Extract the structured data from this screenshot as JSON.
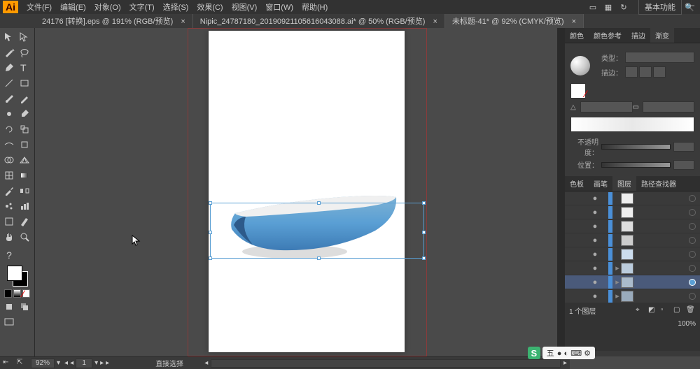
{
  "app": {
    "logo": "Ai"
  },
  "menu": {
    "file": "文件(F)",
    "edit": "编辑(E)",
    "object": "对象(O)",
    "type": "文字(T)",
    "select": "选择(S)",
    "effect": "效果(C)",
    "view": "视图(V)",
    "window": "窗口(W)",
    "help": "帮助(H)"
  },
  "workspace": "基本功能",
  "tabs": [
    {
      "label": "24176 [转换].eps @ 191% (RGB/预览)",
      "close": "×"
    },
    {
      "label": "Nipic_24787180_20190921105616043088.ai* @ 50% (RGB/预览)",
      "close": "×"
    },
    {
      "label": "未标题-41* @ 92% (CMYK/预览)",
      "close": "×"
    }
  ],
  "gradient_panel": {
    "tabs": [
      "颜色",
      "颜色参考",
      "描边",
      "渐变"
    ],
    "type_label": "类型：",
    "stroke_label": "描边：",
    "opacity_label": "不透明度：",
    "position_label": "位置："
  },
  "layers_panel": {
    "tabs": [
      "色板",
      "画笔",
      "图层",
      "路径查找器"
    ],
    "count": "1 个图层",
    "zoom": "100%"
  },
  "statusbar": {
    "zoom": "92%",
    "page": "1",
    "tool_label": "直接选择"
  },
  "ime": "五"
}
